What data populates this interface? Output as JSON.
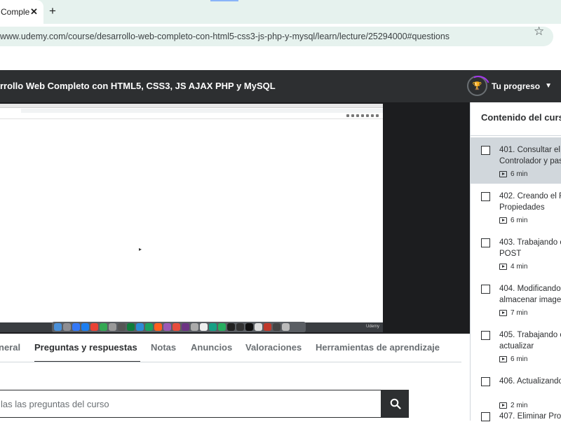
{
  "browser": {
    "tab_title": "Comple",
    "tab_close": "✕",
    "new_tab": "+",
    "url": "www.udemy.com/course/desarrollo-web-completo-con-html5-css3-js-php-y-mysql/learn/lecture/25294000#questions"
  },
  "header": {
    "course_title": "rrollo Web Completo con HTML5, CSS3, JS AJAX PHP y MySQL",
    "progress_label": "Tu progreso"
  },
  "video": {
    "watermark": "Udemy"
  },
  "tabs": [
    {
      "label": "neral"
    },
    {
      "label": "Preguntas y respuestas"
    },
    {
      "label": "Notas"
    },
    {
      "label": "Anuncios"
    },
    {
      "label": "Valoraciones"
    },
    {
      "label": "Herramientas de aprendizaje"
    }
  ],
  "search": {
    "placeholder": "las las preguntas del curso"
  },
  "sidebar": {
    "title": "Contenido del curs",
    "lectures": [
      {
        "title": "401. Consultar el Controlador y pas",
        "duration": "6 min"
      },
      {
        "title": "402. Creando el F Propiedades",
        "duration": "6 min"
      },
      {
        "title": "403. Trabajando c POST",
        "duration": "4 min"
      },
      {
        "title": "404. Modificando almacenar image",
        "duration": "7 min"
      },
      {
        "title": "405. Trabajando c actualizar",
        "duration": "6 min"
      },
      {
        "title": "406. Actualizando",
        "duration": "2 min"
      },
      {
        "title": "407. Eliminar Pro",
        "duration": ""
      }
    ]
  },
  "colors": {
    "header_bg": "#2d2f31",
    "active_lecture_bg": "#d1d7dc",
    "omnibox_bg": "#e6f2ee",
    "accent": "#a435f0"
  }
}
